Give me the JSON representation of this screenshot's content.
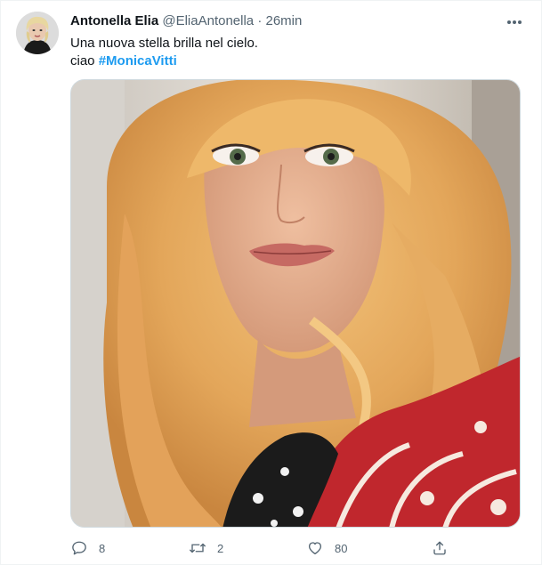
{
  "tweet": {
    "author": {
      "display_name": "Antonella Elia",
      "handle": "@EliaAntonella",
      "separator": "·",
      "time": "26min"
    },
    "text_line1": "Una nuova stella brilla nel cielo.",
    "text_line2_prefix": "ciao ",
    "hashtag": "#MonicaVitti",
    "stats": {
      "replies": "8",
      "retweets": "2",
      "likes": "80"
    }
  },
  "icons": {
    "more": "more-horizontal-icon",
    "reply": "reply-icon",
    "retweet": "retweet-icon",
    "like": "heart-icon",
    "share": "share-icon"
  },
  "colors": {
    "link": "#1d9bf0",
    "secondary_text": "#536471",
    "primary_text": "#0f1419"
  }
}
